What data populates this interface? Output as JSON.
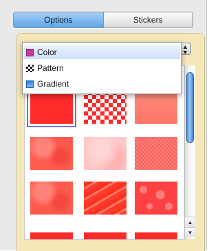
{
  "tabs": [
    {
      "label": "Options",
      "active": true
    },
    {
      "label": "Stickers",
      "active": false
    }
  ],
  "fill_type_menu": {
    "selected": "Color",
    "items": [
      {
        "label": "Color",
        "icon": "color-swatch-icon"
      },
      {
        "label": "Pattern",
        "icon": "pattern-icon"
      },
      {
        "label": "Gradient",
        "icon": "gradient-icon"
      }
    ]
  },
  "swatches": [
    {
      "name": "solid-red",
      "selected": true
    },
    {
      "name": "checker-red"
    },
    {
      "name": "peach"
    },
    {
      "name": "mottled-red"
    },
    {
      "name": "soft-pink"
    },
    {
      "name": "noise-red"
    },
    {
      "name": "textured-red"
    },
    {
      "name": "wave-red"
    },
    {
      "name": "bubbles-red"
    }
  ],
  "colors": {
    "accent": "#5ea4e8",
    "swatch_red": "#ff2a2a",
    "panel_beige": "#f6e7b8"
  }
}
